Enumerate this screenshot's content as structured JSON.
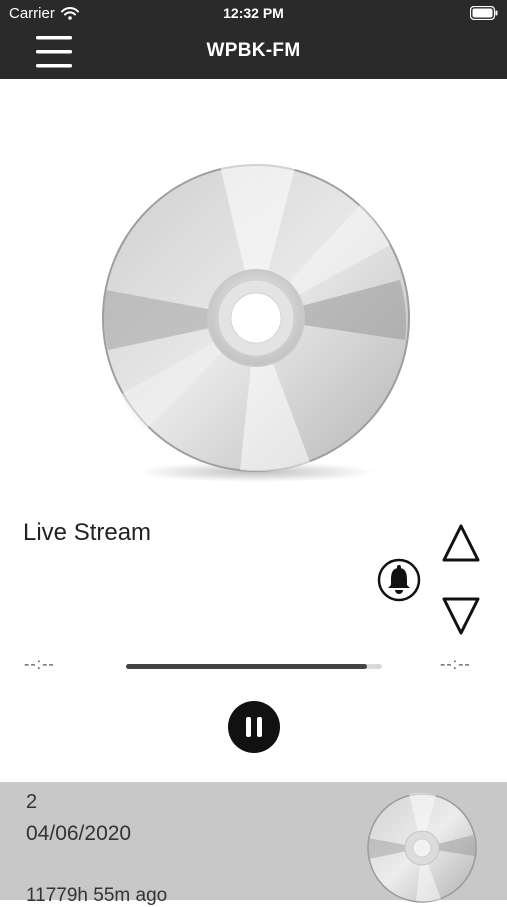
{
  "status_bar": {
    "carrier": "Carrier",
    "time": "12:32 PM"
  },
  "nav": {
    "title": "WPBK-FM"
  },
  "player": {
    "stream_title": "Live Stream",
    "elapsed": "--:--",
    "remaining": "--:--",
    "progress": 0.94
  },
  "history": [
    {
      "number": "2",
      "date": "04/06/2020",
      "ago": "11779h 55m ago"
    }
  ]
}
